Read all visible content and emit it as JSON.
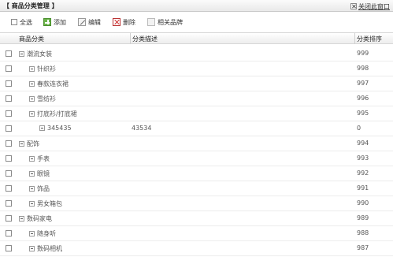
{
  "window": {
    "title": "【 商品分类管理 】",
    "close_label": "关闭此窗口"
  },
  "toolbar": {
    "select_all": "全选",
    "add": "添加",
    "edit": "编辑",
    "delete": "删除",
    "brands": "相关品牌"
  },
  "table": {
    "headers": [
      "商品分类",
      "分类描述",
      "分类排序"
    ],
    "rows": [
      {
        "name": "潮流女装",
        "desc": "",
        "sort": "999",
        "level": 0
      },
      {
        "name": "针织衫",
        "desc": "",
        "sort": "998",
        "level": 1
      },
      {
        "name": "春款连衣裙",
        "desc": "",
        "sort": "997",
        "level": 1
      },
      {
        "name": "雪纺衫",
        "desc": "",
        "sort": "996",
        "level": 1
      },
      {
        "name": "打底衫/打底裙",
        "desc": "",
        "sort": "995",
        "level": 1
      },
      {
        "name": "345435",
        "desc": "43534",
        "sort": "0",
        "level": 2
      },
      {
        "name": "配饰",
        "desc": "",
        "sort": "994",
        "level": 0
      },
      {
        "name": "手表",
        "desc": "",
        "sort": "993",
        "level": 1
      },
      {
        "name": "眼镜",
        "desc": "",
        "sort": "992",
        "level": 1
      },
      {
        "name": "饰品",
        "desc": "",
        "sort": "991",
        "level": 1
      },
      {
        "name": "男女箱包",
        "desc": "",
        "sort": "990",
        "level": 1
      },
      {
        "name": "数码家电",
        "desc": "",
        "sort": "989",
        "level": 0
      },
      {
        "name": "随身听",
        "desc": "",
        "sort": "988",
        "level": 1
      },
      {
        "name": "数码相机",
        "desc": "",
        "sort": "987",
        "level": 1
      }
    ]
  }
}
